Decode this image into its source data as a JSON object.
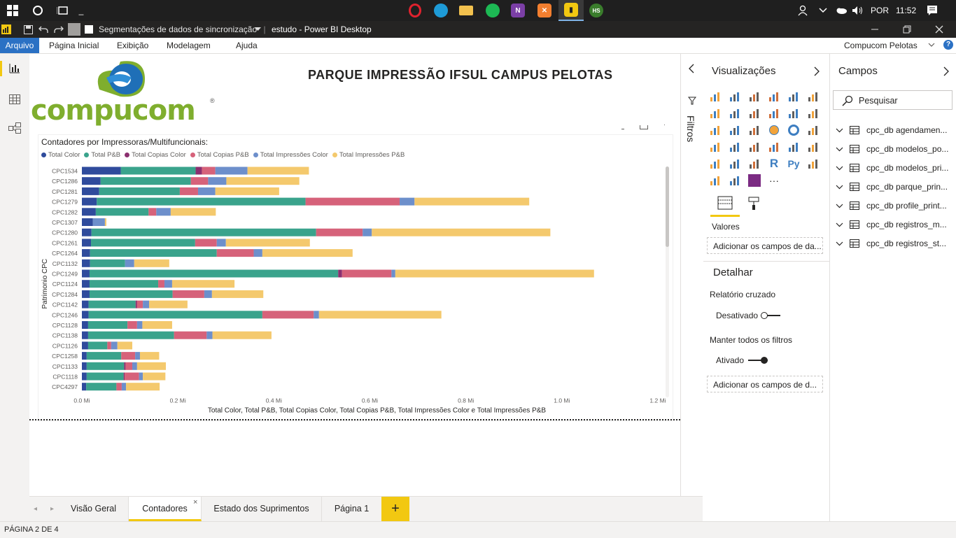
{
  "taskbar": {
    "lang": "POR",
    "time": "11:52"
  },
  "titlebar": {
    "seg_label": "Segmentações de dados de sincronização",
    "title": "estudo - Power BI Desktop",
    "window_buttons": [
      "minimize-icon",
      "maximize-icon",
      "close-icon"
    ]
  },
  "ribbon": {
    "tabs": [
      "Arquivo",
      "Página Inicial",
      "Exibição",
      "Modelagem",
      "Ajuda"
    ],
    "account": "Compucom Pelotas"
  },
  "report": {
    "title": "PARQUE IMPRESSÃO IFSUL CAMPUS PELOTAS",
    "logo_text": "compucom",
    "logo_reg": "®"
  },
  "chart_data": {
    "type": "bar",
    "orientation": "horizontal",
    "stacked": true,
    "title": "Contadores por Impressoras/Multifuncionais:",
    "ylabel": "Patrimonio CPC",
    "xlabel": "Total Color, Total P&B, Total Copias Color, Total Copias P&B, Total Impressões Color e Total Impressões P&B",
    "xlim": [
      0,
      1.2
    ],
    "x_ticks": [
      "0.0 Mi",
      "0.2 Mi",
      "0.4 Mi",
      "0.6 Mi",
      "0.8 Mi",
      "1.0 Mi",
      "1.2 Mi"
    ],
    "legend_position": "top-left",
    "categories": [
      "CPC1534",
      "CPC1286",
      "CPC1281",
      "CPC1279",
      "CPC1282",
      "CPC1307",
      "CPC1280",
      "CPC1261",
      "CPC1264",
      "CPC1132",
      "CPC1249",
      "CPC1124",
      "CPC1284",
      "CPC1142",
      "CPC1246",
      "CPC1128",
      "CPC1138",
      "CPC1126",
      "CPC1258",
      "CPC1133",
      "CPC1118",
      "CPC4297"
    ],
    "series": [
      {
        "name": "Total Color",
        "color": "#2f4b9c",
        "values": [
          0.081,
          0.039,
          0.036,
          0.031,
          0.029,
          0.023,
          0.02,
          0.019,
          0.017,
          0.017,
          0.016,
          0.016,
          0.016,
          0.014,
          0.014,
          0.013,
          0.013,
          0.013,
          0.01,
          0.01,
          0.01,
          0.009
        ]
      },
      {
        "name": "Total P&B",
        "color": "#3aa38c",
        "values": [
          0.156,
          0.188,
          0.168,
          0.435,
          0.11,
          0.0,
          0.468,
          0.217,
          0.264,
          0.073,
          0.518,
          0.143,
          0.173,
          0.098,
          0.362,
          0.082,
          0.179,
          0.04,
          0.072,
          0.078,
          0.077,
          0.063
        ]
      },
      {
        "name": "Total Copias Color",
        "color": "#8b2f6f",
        "values": [
          0.013,
          0.0,
          0.0,
          0.0,
          0.0,
          0.0,
          0.0,
          0.0,
          0.0,
          0.0,
          0.008,
          0.0,
          0.0,
          0.003,
          0.0,
          0.0,
          0.0,
          0.0,
          0.0,
          0.003,
          0.002,
          0.0
        ]
      },
      {
        "name": "Total Copias P&B",
        "color": "#d6627a",
        "values": [
          0.028,
          0.036,
          0.038,
          0.196,
          0.016,
          0.0,
          0.097,
          0.045,
          0.077,
          0.0,
          0.103,
          0.013,
          0.066,
          0.012,
          0.107,
          0.02,
          0.068,
          0.008,
          0.029,
          0.014,
          0.03,
          0.011
        ]
      },
      {
        "name": "Total Impressões Color",
        "color": "#6d8fcb",
        "values": [
          0.067,
          0.038,
          0.036,
          0.031,
          0.03,
          0.025,
          0.019,
          0.019,
          0.018,
          0.019,
          0.008,
          0.016,
          0.016,
          0.013,
          0.011,
          0.011,
          0.012,
          0.013,
          0.01,
          0.01,
          0.008,
          0.009
        ]
      },
      {
        "name": "Total Impressões P&B",
        "color": "#f4c96d",
        "values": [
          0.128,
          0.152,
          0.133,
          0.239,
          0.094,
          0.003,
          0.372,
          0.175,
          0.188,
          0.073,
          0.414,
          0.13,
          0.107,
          0.08,
          0.255,
          0.062,
          0.123,
          0.031,
          0.04,
          0.06,
          0.047,
          0.07
        ]
      }
    ]
  },
  "filtros": {
    "label": "Filtros"
  },
  "viz_pane": {
    "title": "Visualizações",
    "valores_label": "Valores",
    "valores_drop": "Adicionar os campos de da...",
    "detalhar_title": "Detalhar",
    "relatorio_label": "Relatório cruzado",
    "relatorio_state": "Desativado",
    "manter_label": "Manter todos os filtros",
    "manter_state": "Ativado",
    "drill_drop": "Adicionar os campos de d..."
  },
  "fields_pane": {
    "title": "Campos",
    "search_placeholder": "Pesquisar",
    "tables": [
      "cpc_db agendamen...",
      "cpc_db modelos_po...",
      "cpc_db modelos_pri...",
      "cpc_db parque_prin...",
      "cpc_db profile_print...",
      "cpc_db registros_m...",
      "cpc_db registros_st..."
    ]
  },
  "page_tabs": {
    "tabs": [
      "Visão Geral",
      "Contadores",
      "Estado dos Suprimentos",
      "Página 1"
    ],
    "active": "Contadores",
    "add": "+"
  },
  "status": {
    "text": "PÁGINA 2 DE 4"
  }
}
